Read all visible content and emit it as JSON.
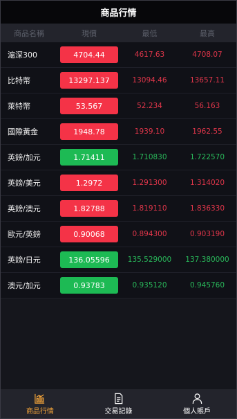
{
  "header": {
    "title": "商品行情"
  },
  "columns": {
    "name": "商品名稱",
    "current": "現價",
    "low": "最低",
    "high": "最高"
  },
  "colors": {
    "up": "#f43347",
    "down": "#1dba54",
    "active_tab": "#f0a23a"
  },
  "quotes": [
    {
      "name": "滬深300",
      "current": "4704.44",
      "low": "4617.63",
      "high": "4708.07",
      "trend": "up"
    },
    {
      "name": "比特幣",
      "current": "13297.137",
      "low": "13094.46",
      "high": "13657.11",
      "trend": "up"
    },
    {
      "name": "萊特幣",
      "current": "53.567",
      "low": "52.234",
      "high": "56.163",
      "trend": "up"
    },
    {
      "name": "國際黃金",
      "current": "1948.78",
      "low": "1939.10",
      "high": "1962.55",
      "trend": "up"
    },
    {
      "name": "英鎊/加元",
      "current": "1.71411",
      "low": "1.710830",
      "high": "1.722570",
      "trend": "down"
    },
    {
      "name": "英鎊/美元",
      "current": "1.2972",
      "low": "1.291300",
      "high": "1.314020",
      "trend": "up"
    },
    {
      "name": "英鎊/澳元",
      "current": "1.82788",
      "low": "1.819110",
      "high": "1.836330",
      "trend": "up"
    },
    {
      "name": "歐元/英鎊",
      "current": "0.90068",
      "low": "0.894300",
      "high": "0.903190",
      "trend": "up"
    },
    {
      "name": "英鎊/日元",
      "current": "136.05596",
      "low": "135.529000",
      "high": "137.380000",
      "trend": "down"
    },
    {
      "name": "澳元/加元",
      "current": "0.93783",
      "low": "0.935120",
      "high": "0.945760",
      "trend": "down"
    }
  ],
  "tabs": [
    {
      "label": "商品行情",
      "icon": "chart-icon",
      "active": true
    },
    {
      "label": "交易記錄",
      "icon": "document-icon",
      "active": false
    },
    {
      "label": "個人賬戶",
      "icon": "user-icon",
      "active": false
    }
  ]
}
